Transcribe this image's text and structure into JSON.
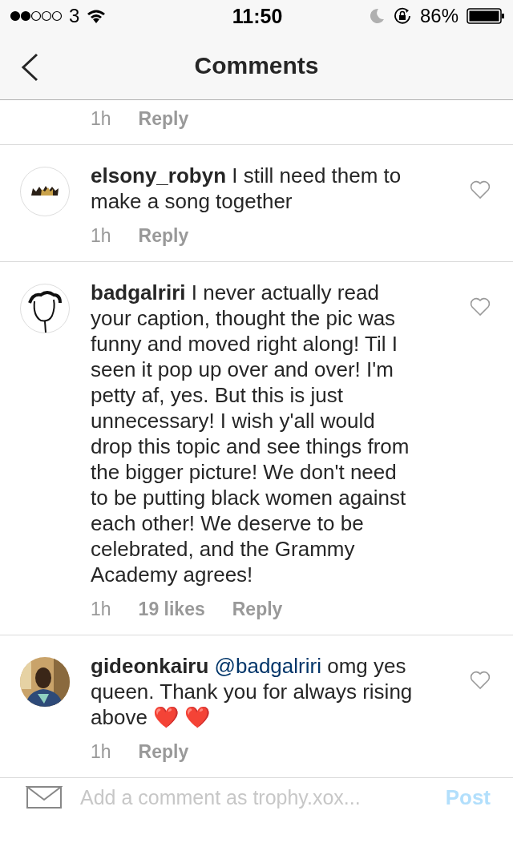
{
  "status_bar": {
    "carrier": "3",
    "time": "11:50",
    "battery": "86%"
  },
  "nav": {
    "title": "Comments"
  },
  "comments": [
    {
      "time": "1h",
      "reply": "Reply"
    },
    {
      "kind": "crown",
      "username": "elsony_robyn",
      "text": "I still need them to make a song together",
      "time": "1h",
      "reply": "Reply"
    },
    {
      "kind": "sketch",
      "username": "badgalriri",
      "text": "I never actually read your caption, thought the pic was funny and moved right along! Til I seen it pop up over and over! I'm petty af, yes. But this is just unnecessary! I wish y'all would drop this topic and see things from the bigger picture! We don't need to be putting black women against each other! We deserve to be celebrated, and the Grammy Academy agrees!",
      "time": "1h",
      "likes": "19 likes",
      "reply": "Reply"
    },
    {
      "username": "gideonkairu",
      "mention": "@badgalriri",
      "text": "omg yes queen. Thank you for always rising above",
      "emojis": [
        "❤️",
        "❤️"
      ],
      "time": "1h",
      "reply": "Reply"
    }
  ],
  "composer": {
    "placeholder": "Add a comment as trophy.xox...",
    "post": "Post"
  }
}
